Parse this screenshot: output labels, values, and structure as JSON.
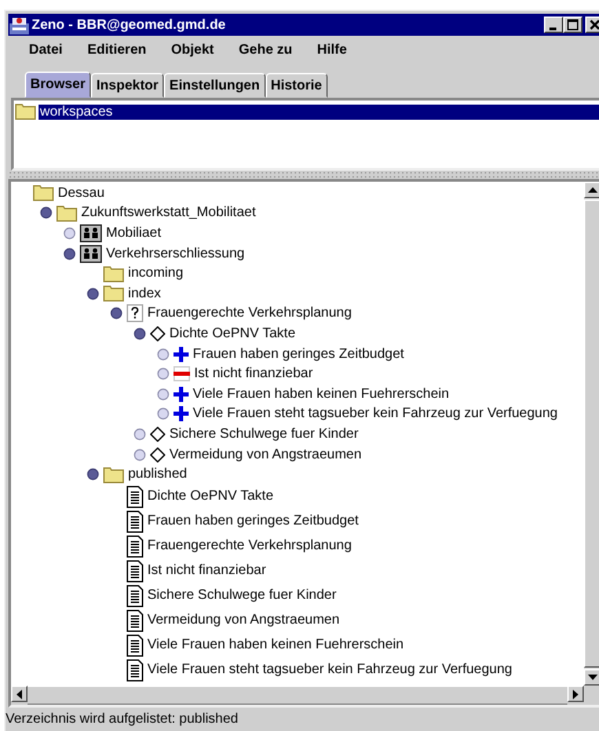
{
  "window": {
    "title": "Zeno - BBR@geomed.gmd.de"
  },
  "menu": [
    "Datei",
    "Editieren",
    "Objekt",
    "Gehe zu",
    "Hilfe"
  ],
  "tabs": [
    {
      "label": "Browser",
      "selected": true
    },
    {
      "label": "Inspektor",
      "selected": false
    },
    {
      "label": "Einstellungen",
      "selected": false
    },
    {
      "label": "Historie",
      "selected": false
    }
  ],
  "workspaces": [
    {
      "label": "workspaces",
      "kind": "folder",
      "selected": true
    }
  ],
  "tree": [
    {
      "label": "Dessau",
      "kind": "folder",
      "children": [
        {
          "label": "Zukunftswerkstatt_Mobilitaet",
          "kind": "folder",
          "expanded": true,
          "children": [
            {
              "label": "Mobiliaet",
              "kind": "group",
              "expanded": false
            },
            {
              "label": "Verkehrserschliessung",
              "kind": "group",
              "expanded": true,
              "children": [
                {
                  "label": "incoming",
                  "kind": "folder"
                },
                {
                  "label": "index",
                  "kind": "folder",
                  "expanded": true,
                  "children": [
                    {
                      "label": "Frauengerechte Verkehrsplanung",
                      "kind": "question",
                      "expanded": true,
                      "children": [
                        {
                          "label": "Dichte OePNV Takte",
                          "kind": "issue",
                          "expanded": true,
                          "children": [
                            {
                              "label": "Frauen haben geringes Zeitbudget",
                              "kind": "pro",
                              "expanded": false
                            },
                            {
                              "label": "Ist nicht finanziebar",
                              "kind": "con",
                              "expanded": false
                            },
                            {
                              "label": "Viele Frauen haben keinen Fuehrerschein",
                              "kind": "pro",
                              "expanded": false
                            },
                            {
                              "label": "Viele Frauen steht  tagsueber kein Fahrzeug zur Verfuegung",
                              "kind": "pro",
                              "expanded": false
                            }
                          ]
                        },
                        {
                          "label": "Sichere Schulwege fuer Kinder",
                          "kind": "issue",
                          "expanded": false
                        },
                        {
                          "label": "Vermeidung von Angstraeumen",
                          "kind": "issue",
                          "expanded": false
                        }
                      ]
                    }
                  ]
                },
                {
                  "label": "published",
                  "kind": "folder",
                  "expanded": true,
                  "children": [
                    {
                      "label": "Dichte OePNV Takte",
                      "kind": "document"
                    },
                    {
                      "label": "Frauen haben geringes Zeitbudget",
                      "kind": "document"
                    },
                    {
                      "label": "Frauengerechte Verkehrsplanung",
                      "kind": "document"
                    },
                    {
                      "label": "Ist nicht finanziebar",
                      "kind": "document"
                    },
                    {
                      "label": "Sichere Schulwege fuer Kinder",
                      "kind": "document"
                    },
                    {
                      "label": "Vermeidung von Angstraeumen",
                      "kind": "document"
                    },
                    {
                      "label": "Viele Frauen haben keinen Fuehrerschein",
                      "kind": "document"
                    },
                    {
                      "label": "Viele Frauen steht  tagsueber kein Fahrzeug zur Verfuegung",
                      "kind": "document"
                    }
                  ]
                }
              ]
            }
          ]
        }
      ]
    }
  ],
  "status_bar": "Verzeichnis wird aufgelistet: published"
}
